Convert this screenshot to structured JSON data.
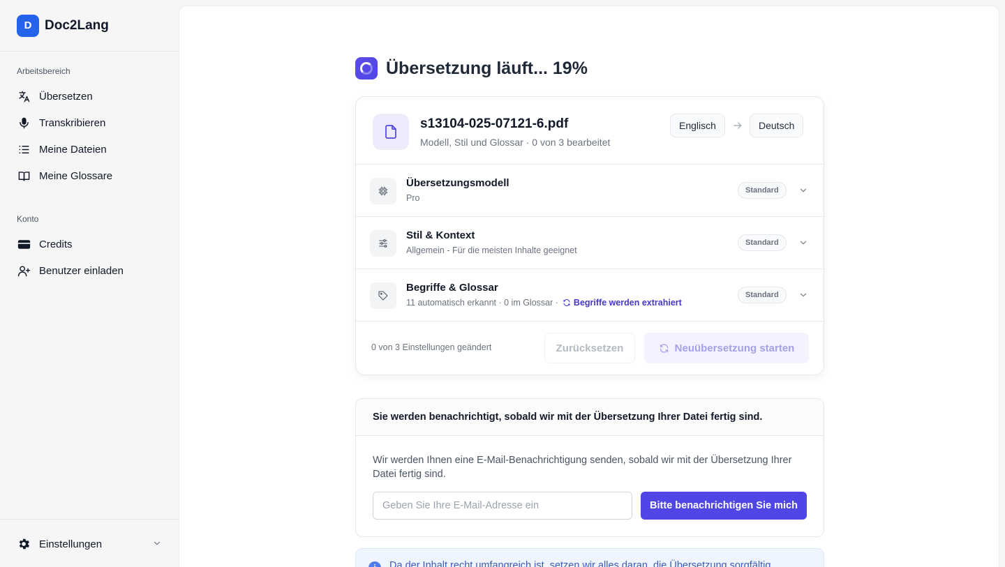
{
  "sidebar": {
    "brand_letter": "D",
    "brand_name": "Doc2Lang",
    "workspace_label": "Arbeitsbereich",
    "workspace_items": [
      {
        "label": "Übersetzen",
        "icon": "translate-icon"
      },
      {
        "label": "Transkribieren",
        "icon": "microphone-icon"
      },
      {
        "label": "Meine Dateien",
        "icon": "list-icon"
      },
      {
        "label": "Meine Glossare",
        "icon": "book-icon"
      }
    ],
    "account_label": "Konto",
    "account_items": [
      {
        "label": "Credits",
        "icon": "credit-card-icon"
      },
      {
        "label": "Benutzer einladen",
        "icon": "user-plus-icon"
      }
    ],
    "settings_label": "Einstellungen"
  },
  "header": {
    "title": "Übersetzung läuft... 19%",
    "progress_percent": 19
  },
  "file": {
    "name": "s13104-025-07121-6.pdf",
    "subtitle": "Modell, Stil und Glossar · 0 von 3 bearbeitet",
    "source_lang": "Englisch",
    "target_lang": "Deutsch"
  },
  "settings": [
    {
      "title": "Übersetzungsmodell",
      "subtitle": "Pro",
      "badge": "Standard",
      "icon": "chip-icon"
    },
    {
      "title": "Stil & Kontext",
      "subtitle": "Allgemein - Für die meisten Inhalte geeignet",
      "badge": "Standard",
      "icon": "sliders-icon"
    },
    {
      "title": "Begriffe & Glossar",
      "subtitle": "11 automatisch erkannt · 0 im Glossar ·",
      "extract_text": "Begriffe werden extrahiert",
      "badge": "Standard",
      "icon": "tag-icon"
    }
  ],
  "footer": {
    "changed_text": "0 von 3 Einstellungen geändert",
    "reset_label": "Zurücksetzen",
    "restart_label": "Neuübersetzung starten"
  },
  "notify": {
    "heading": "Sie werden benachrichtigt, sobald wir mit der Übersetzung Ihrer Datei fertig sind.",
    "body": "Wir werden Ihnen eine E-Mail-Benachrichtigung senden, sobald wir mit der Übersetzung Ihrer Datei fertig sind.",
    "email_placeholder": "Geben Sie Ihre E-Mail-Adresse ein",
    "email_value": "",
    "button_label": "Bitte benachrichtigen Sie mich"
  },
  "info": {
    "text": "Da der Inhalt recht umfangreich ist, setzen wir alles daran, die Übersetzung sorgfältig"
  },
  "colors": {
    "accent": "#4f46e5",
    "brand": "#2563eb",
    "link": "#4338ca"
  }
}
